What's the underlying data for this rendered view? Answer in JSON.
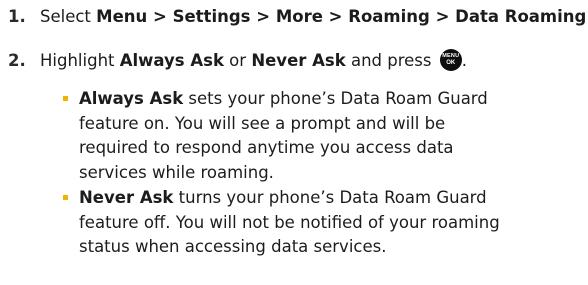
{
  "step1": {
    "number": "1.",
    "prefix": "Select ",
    "menu": "Menu",
    "sep1": " > ",
    "settings": "Settings",
    "sep2": " > ",
    "more": "More",
    "sep3": " > ",
    "roaming": "Roaming",
    "sep4": " > ",
    "data_roaming": "Data Roaming",
    "end": "."
  },
  "step2": {
    "number": "2.",
    "prefix": "Highlight ",
    "always_ask": "Always Ask",
    "or": " or ",
    "never_ask": "Never Ask",
    "and_press": " and press ",
    "button_top": "MENU",
    "button_bottom": "OK",
    "end": "."
  },
  "bullets": [
    {
      "term": "Always Ask",
      "lines": [
        " sets your phone’s Data Roam Guard",
        "feature on. You will see a prompt and will be",
        "required to respond anytime you access data",
        "services while roaming."
      ]
    },
    {
      "term": "Never Ask",
      "lines": [
        " turns your phone’s Data Roam Guard",
        "feature off. You will not be notified of your roaming",
        "status when accessing data services."
      ]
    }
  ]
}
